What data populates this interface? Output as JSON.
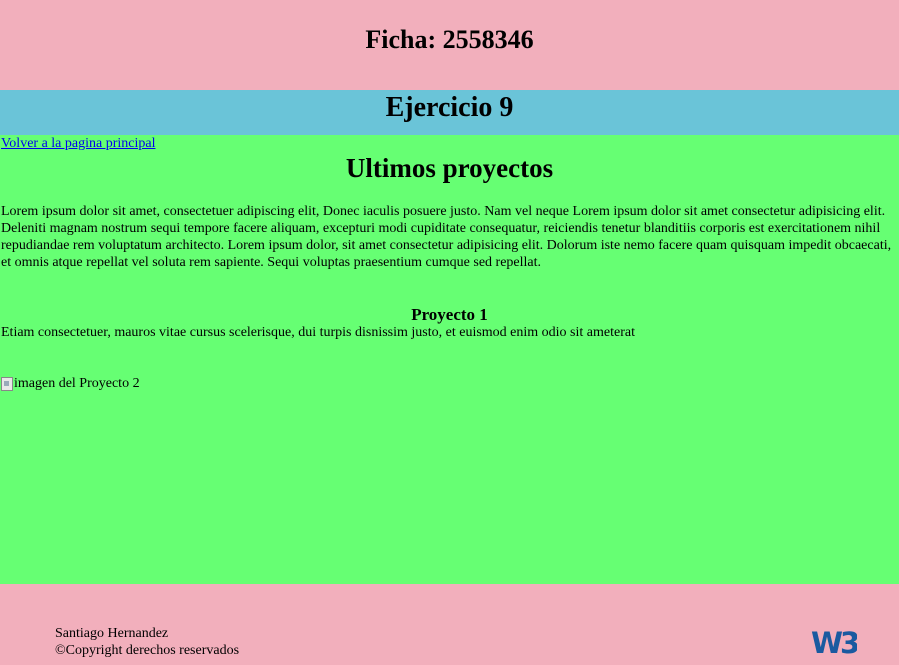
{
  "header": {
    "title": "Ficha: 2558346"
  },
  "subheader": {
    "title": "Ejercicio 9"
  },
  "main": {
    "back_link": "Volver a la pagina principal",
    "section_title": "Ultimos proyectos",
    "intro": "Lorem ipsum dolor sit amet, consectetuer adipiscing elit, Donec iaculis posuere justo. Nam vel neque Lorem ipsum dolor sit amet consectetur adipisicing elit. Deleniti magnam nostrum sequi tempore facere aliquam, excepturi modi cupiditate consequatur, reiciendis tenetur blanditiis corporis est exercitationem nihil repudiandae rem voluptatum architecto. Lorem ipsum dolor, sit amet consectetur adipisicing elit. Dolorum iste nemo facere quam quisquam impedit obcaecati, et omnis atque repellat vel soluta rem sapiente. Sequi voluptas praesentium cumque sed repellat.",
    "project": {
      "title": "Proyecto 1",
      "description": "Etiam consectetuer, mauros vitae cursus scelerisque, dui turpis disnissim justo, et euismod enim odio sit ameterat",
      "image_alt": "imagen del Proyecto 2"
    }
  },
  "footer": {
    "author": "Santiago Hernandez",
    "copyright": "©Copyright derechos reservados",
    "logo_text": "W3C"
  },
  "colors": {
    "header_bg": "#f2afbc",
    "subheader_bg": "#6ac4d8",
    "main_bg": "#66ff73",
    "link": "#0000ee",
    "w3c_blue": "#1a5aa0"
  }
}
